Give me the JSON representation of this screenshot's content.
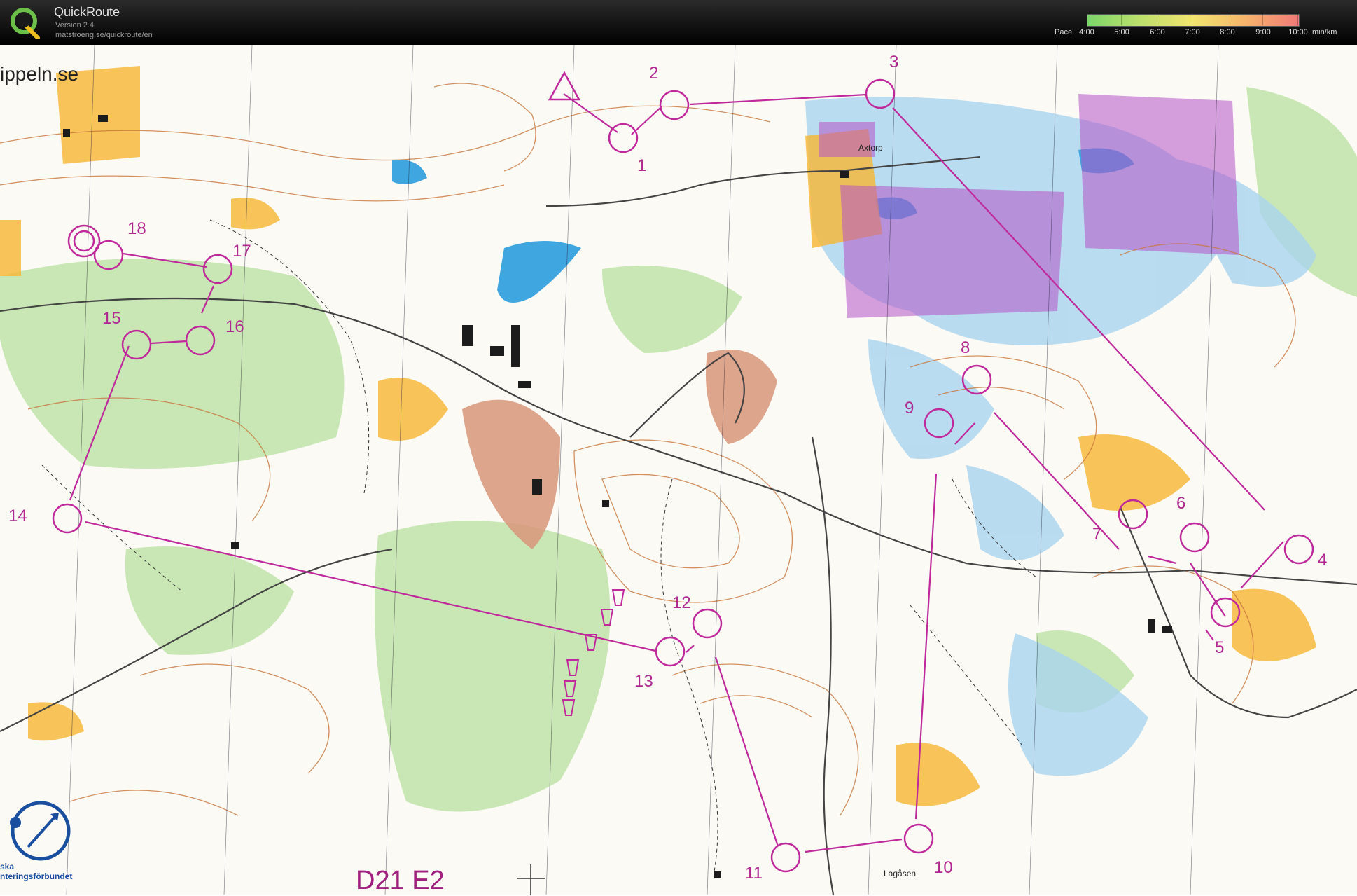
{
  "app": {
    "name": "QuickRoute",
    "version": "Version 2.4",
    "url": "matstroeng.se/quickroute/en",
    "logo_icon": "quickroute-q-logo"
  },
  "pace_scale": {
    "label": "Pace",
    "ticks": [
      "4:00",
      "5:00",
      "6:00",
      "7:00",
      "8:00",
      "9:00",
      "10:00"
    ],
    "unit": "min/km",
    "colors": [
      "#7bd56a",
      "#bde06c",
      "#f2e46e",
      "#f6b46c",
      "#f07a78"
    ]
  },
  "map": {
    "corner_text": "ippeln.se",
    "class_label": "D21 E2",
    "federation_text_line1": "ska",
    "federation_text_line2": "nteringsförbundet",
    "place_names": [
      "Axtorp",
      "Lagåsen"
    ],
    "course_color": "#c0299c",
    "start_icon": "start-triangle",
    "controls": [
      {
        "number": "1"
      },
      {
        "number": "2"
      },
      {
        "number": "3"
      },
      {
        "number": "4"
      },
      {
        "number": "5"
      },
      {
        "number": "6"
      },
      {
        "number": "7"
      },
      {
        "number": "8"
      },
      {
        "number": "9"
      },
      {
        "number": "10"
      },
      {
        "number": "11"
      },
      {
        "number": "12"
      },
      {
        "number": "13"
      },
      {
        "number": "14"
      },
      {
        "number": "15"
      },
      {
        "number": "16"
      },
      {
        "number": "17"
      },
      {
        "number": "18"
      }
    ]
  }
}
